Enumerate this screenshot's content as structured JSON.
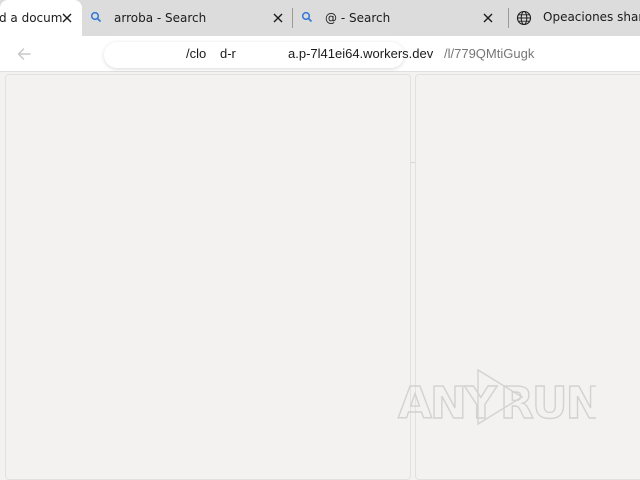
{
  "tabs": [
    {
      "label": "d a docum",
      "icon": "close-icon"
    },
    {
      "label": "arroba - Search",
      "icon": "search-icon"
    },
    {
      "label": "@ - Search",
      "icon": "search-icon"
    },
    {
      "label": "Opeaciones shared",
      "icon": "globe-icon"
    }
  ],
  "toolbar": {
    "url_parts": [
      "/clo",
      "d-r",
      "a.p-7l41ei64.workers.dev",
      "/l/779QMtiGugk"
    ]
  },
  "watermark": {
    "text": "ANY RUN",
    "left": "ANY",
    "right": "RUN"
  },
  "colors": {
    "tabstrip": "#dcdcdc",
    "active_tab": "#ffffff",
    "search_icon": "#3a7bd5",
    "page_bg": "#f3f2f1"
  }
}
